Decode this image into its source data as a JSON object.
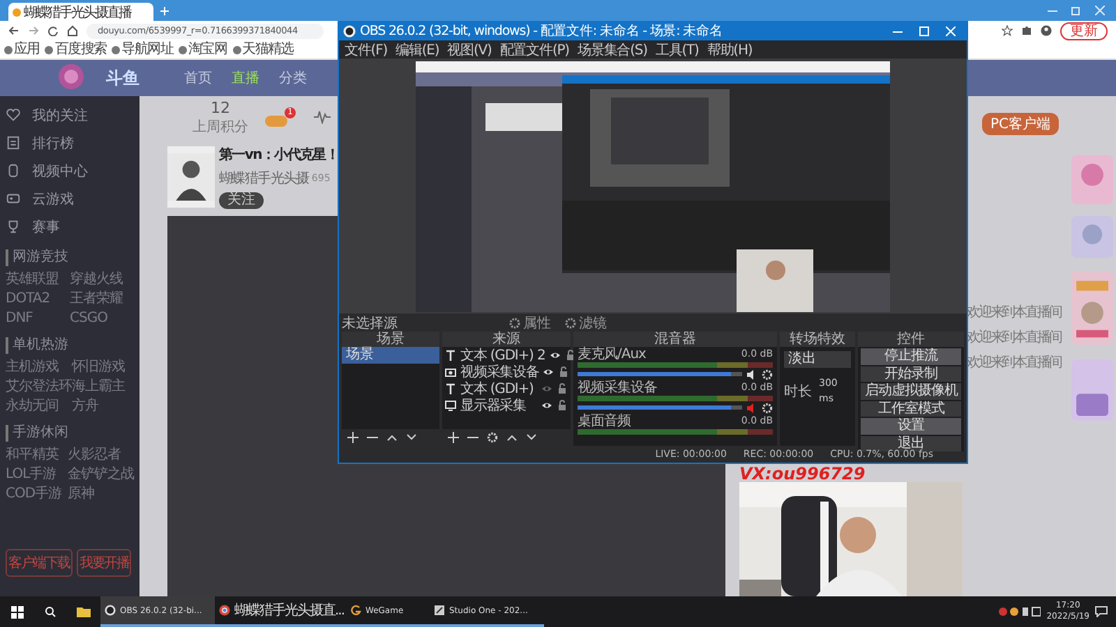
{
  "browser": {
    "tab": {
      "title": "蝴蝶猎手光头摄直播"
    },
    "address": "douyu.com/6539997_r=0.7166399371840044",
    "update_button": "更新",
    "bookmarks": [
      "应用",
      "百度搜索",
      "导航网址",
      "淘宝网",
      "天猫精选"
    ]
  },
  "site": {
    "logo": "斗鱼",
    "nav": [
      {
        "label": "首页",
        "selected": false
      },
      {
        "label": "直播",
        "selected": true
      },
      {
        "label": "分类",
        "selected": false
      }
    ],
    "sidebar": {
      "items": [
        "我的关注",
        "排行榜",
        "视频中心",
        "云游戏",
        "赛事"
      ],
      "sections": [
        {
          "title": "网游竞技",
          "games": [
            "英雄联盟",
            "穿越火线",
            "DOTA2",
            "王者荣耀",
            "DNF",
            "CSGO"
          ]
        },
        {
          "title": "单机热游",
          "games": [
            "主机游戏",
            "怀旧游戏",
            "艾尔登法环",
            "海上霸主",
            "永劫无间",
            "方舟"
          ]
        },
        {
          "title": "手游休闲",
          "games": [
            "和平精英",
            "火影忍者",
            "LOL手游",
            "金铲铲之战",
            "COD手游",
            "原神"
          ]
        }
      ],
      "footer_buttons": [
        "客户端下载",
        "我要开播"
      ]
    },
    "stats": {
      "score": "12",
      "score_label": "上周积分",
      "badge": "1"
    },
    "streamer": {
      "title": "第一vn：小代克星！",
      "name": "蝴蝶猎手光头摄",
      "heat": "695",
      "follow": "关注"
    },
    "right": {
      "client_button": "PC客户端",
      "chat": [
        "欢迎来到本直播间",
        "欢迎来到本直播间",
        "欢迎来到本直播间"
      ]
    },
    "stream_overlay": "VX:ou996729"
  },
  "obs": {
    "title": "OBS 26.0.2 (32-bit, windows) - 配置文件: 未命名 - 场景: 未命名",
    "menu": [
      "文件(F)",
      "编辑(E)",
      "视图(V)",
      "配置文件(P)",
      "场景集合(S)",
      "工具(T)",
      "帮助(H)"
    ],
    "source_bar": {
      "label": "未选择源",
      "buttons": [
        "属性",
        "滤镜"
      ]
    },
    "docks": {
      "scenes": "场景",
      "sources": "来源",
      "mixer": "混音器",
      "transitions": "转场特效",
      "controls": "控件"
    },
    "scenes": [
      {
        "name": "场景",
        "selected": true
      }
    ],
    "sources": [
      {
        "name": "文本 (GDI+) 2",
        "kind": "text",
        "visible": true
      },
      {
        "name": "视频采集设备",
        "kind": "camera",
        "visible": true
      },
      {
        "name": "文本 (GDI+)",
        "kind": "text",
        "visible": false
      },
      {
        "name": "显示器采集",
        "kind": "monitor",
        "visible": true
      }
    ],
    "mixer": [
      {
        "name": "麦克风/Aux",
        "reading": "0.0 dB",
        "level": 0.93,
        "muted": false
      },
      {
        "name": "视频采集设备",
        "reading": "0.0 dB",
        "level": 0.93,
        "muted": true
      },
      {
        "name": "桌面音频",
        "reading": "0.0 dB"
      }
    ],
    "transition": {
      "type": "淡出",
      "duration_label": "时长",
      "duration": "300 ms"
    },
    "controls": [
      {
        "label": "停止推流",
        "selected": true
      },
      {
        "label": "开始录制",
        "selected": false
      },
      {
        "label": "启动虚拟摄像机",
        "selected": false
      },
      {
        "label": "工作室模式",
        "selected": false
      },
      {
        "label": "设置",
        "selected": true
      },
      {
        "label": "退出",
        "selected": false
      }
    ],
    "status": {
      "live": "LIVE: 00:00:00",
      "rec": "REC: 00:00:00",
      "cpu": "CPU: 0.7%, 60.00 fps"
    }
  },
  "taskbar": {
    "apps": [
      {
        "label": "OBS 26.0.2 (32-bi...",
        "selected": true
      },
      {
        "label": "蝴蝶猎手光头摄直...",
        "selected": false
      },
      {
        "label": "WeGame",
        "selected": false
      },
      {
        "label": "Studio One - 202...",
        "selected": false
      }
    ],
    "time": "17:20",
    "date": "2022/5/19"
  }
}
